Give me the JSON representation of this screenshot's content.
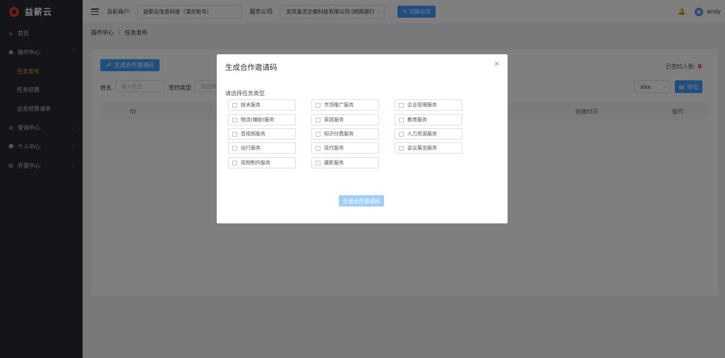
{
  "app": {
    "name": "益薪云"
  },
  "sidebar": {
    "items": [
      {
        "label": "首页",
        "icon": "home-icon"
      },
      {
        "label": "操作中心",
        "icon": "operation-icon",
        "expanded": true,
        "children": [
          {
            "label": "任务发布",
            "active": true
          },
          {
            "label": "任务结算"
          },
          {
            "label": "业务结算清单"
          }
        ]
      },
      {
        "label": "查询中心",
        "icon": "query-icon"
      },
      {
        "label": "个人中心",
        "icon": "user-icon"
      },
      {
        "label": "开票中心",
        "icon": "invoice-icon"
      }
    ]
  },
  "header": {
    "merchant_label": "当前商户:",
    "merchant_value": "益薪云信息科技（演示账号）",
    "company_label": "服务公司:",
    "company_value": "安庆嘉灵企服科技有限公司 (网商银行",
    "switch_label": "切换公司",
    "username": "andy"
  },
  "breadcrumb": {
    "parent": "操作中心",
    "separator": "/",
    "current": "任务发布"
  },
  "main": {
    "generate_button": "生成合作邀请码",
    "signed_label": "已签约人数:",
    "signed_count": "0",
    "filters": {
      "name_label": "姓名",
      "name_placeholder": "输入姓名",
      "type_label": "签约类型",
      "type_placeholder": "请选择"
    },
    "export_format": "xlsx",
    "export_button": "导出",
    "table_headers": {
      "id": "ID",
      "created": "创建时间",
      "actions": "操作"
    }
  },
  "modal": {
    "title": "生成合作邀请码",
    "subtitle": "请选择任务类型",
    "options": [
      "技术服务",
      "市场推广服务",
      "企业管理服务",
      "物流(辅助)服务",
      "家政服务",
      "教育服务",
      "音视频服务",
      "知识付费服务",
      "人力资源服务",
      "出行服务",
      "现代服务",
      "会议展览服务",
      "视频制作服务",
      "摄影服务"
    ],
    "submit_button": "生成合作邀请码"
  },
  "colors": {
    "primary": "#409eff",
    "sidebar_bg": "#262a31",
    "active_menu": "#e6a23c",
    "brand": "#e8362c"
  }
}
